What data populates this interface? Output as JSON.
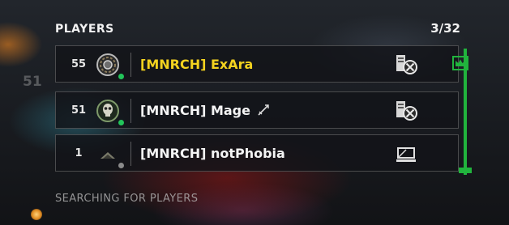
{
  "header": {
    "title": "PLAYERS",
    "count": "3/32"
  },
  "background": {
    "ghost_level": "51"
  },
  "players": [
    {
      "level": "55",
      "name": "[MNRCH] ExAra",
      "emblem": "star-ring-emblem-icon",
      "status": "online",
      "platform": "xbox-pc-icon",
      "leader": true
    },
    {
      "level": "51",
      "name": "[MNRCH] Mage",
      "emblem": "skull-emblem-icon",
      "status": "online",
      "platform": "xbox-pc-icon"
    },
    {
      "level": "1",
      "name": "[MNRCH] notPhobia",
      "emblem": "chevron-rank-icon",
      "status": "offline",
      "platform": "pc-monitor-icon"
    }
  ],
  "footer": {
    "status_text": "SEARCHING FOR PLAYERS"
  },
  "colors": {
    "accent_green": "#21b43d",
    "leader_name": "#f3d21f",
    "online_dot": "#22c45a",
    "offline_dot": "#8a8a8a"
  }
}
